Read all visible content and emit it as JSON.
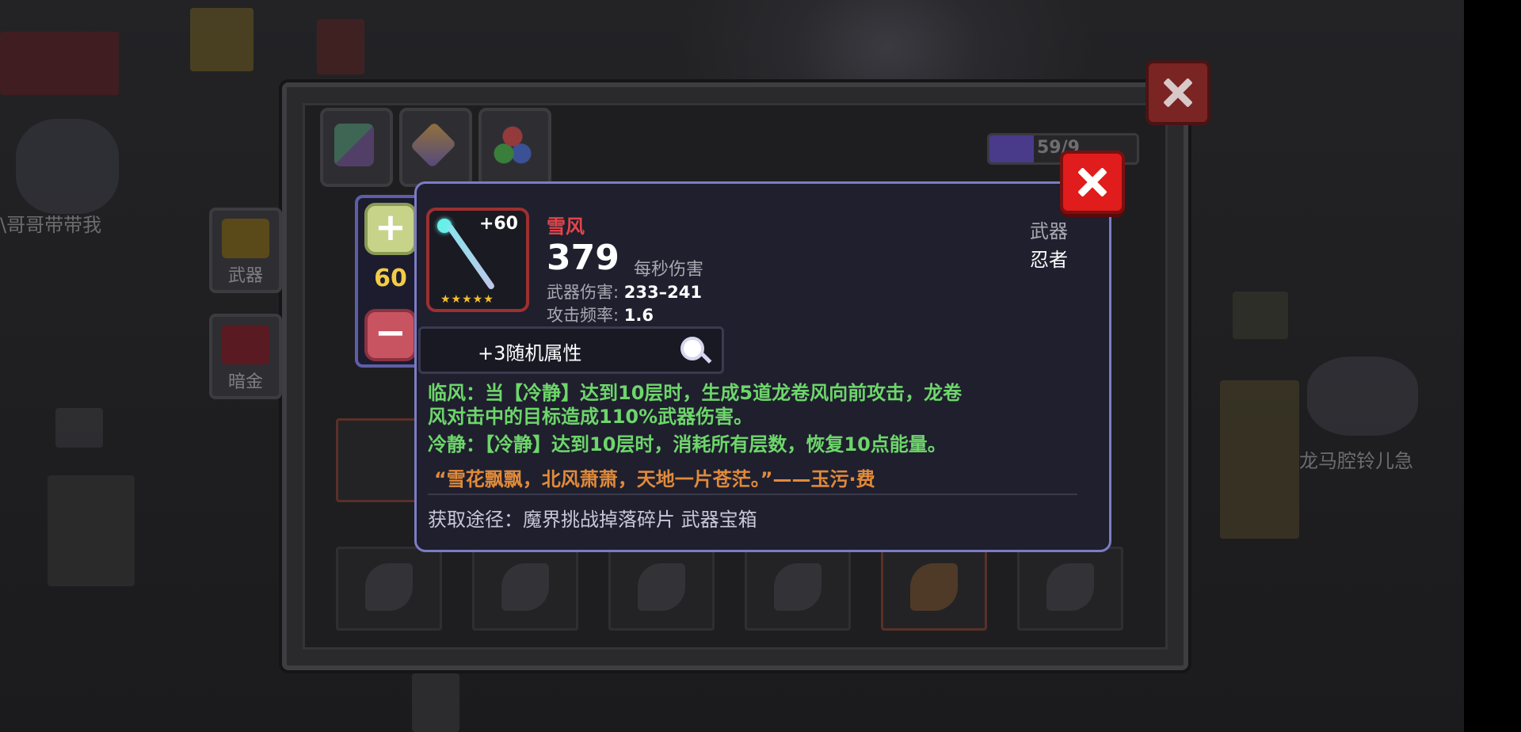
{
  "background": {
    "player_name_left": "\\哥哥带带我",
    "player_name_right": "龙马腔铃儿急"
  },
  "inventory": {
    "exp_text": "59/9",
    "exp_fraction": 0.3,
    "categories": [
      "武器",
      "暗金"
    ]
  },
  "stepper": {
    "plus": "+",
    "quantity": "60",
    "minus": "−"
  },
  "item": {
    "name": "雪风",
    "level_badge": "+60",
    "stars": "★★★★★",
    "dps": "379",
    "dps_label": "每秒伤害",
    "damage_label": "武器伤害:",
    "damage_value": "233–241",
    "rate_label": "攻击频率:",
    "rate_value": "1.6",
    "type": "武器",
    "class": "忍者",
    "random_attr": "+3随机属性",
    "effect_line1": "临风：当【冷静】达到10层时，生成5道龙卷风向前攻击，龙卷",
    "effect_line2": "风对击中的目标造成110%武器伤害。",
    "effect_line3": "冷静：【冷静】达到10层时，消耗所有层数，恢复10点能量。",
    "quote": "“雪花飘飘，北风萧萧，天地一片苍茫。”——玉污·费",
    "source": "获取途径：魔界挑战掉落碎片 武器宝箱"
  },
  "colors": {
    "name_red": "#e2454a",
    "effect_green": "#6dd66a",
    "quote_orange": "#e08a3a",
    "quantity_yellow": "#f2cc48"
  }
}
